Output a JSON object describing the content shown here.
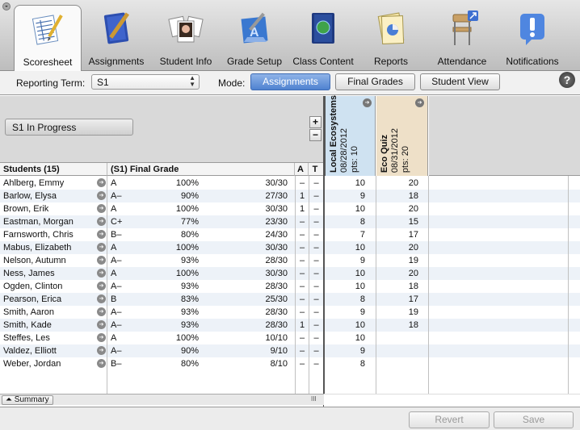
{
  "toolbar": {
    "items": [
      {
        "label": "Scoresheet",
        "icon": "scoresheet-icon",
        "active": true
      },
      {
        "label": "Assignments",
        "icon": "notebook-icon"
      },
      {
        "label": "Student Info",
        "icon": "photos-icon"
      },
      {
        "label": "Grade Setup",
        "icon": "blueprint-icon"
      },
      {
        "label": "Class Content",
        "icon": "globe-book-icon"
      },
      {
        "label": "Reports",
        "icon": "reports-icon"
      },
      {
        "label": "Attendance",
        "icon": "chair-icon"
      },
      {
        "label": "Notifications",
        "icon": "exclamation-icon"
      }
    ]
  },
  "filters": {
    "reporting_term_label": "Reporting Term:",
    "reporting_term_value": "S1",
    "mode_label": "Mode:",
    "modes": [
      "Assignments",
      "Final Grades",
      "Student View"
    ],
    "selected_mode": "Assignments",
    "help": "?"
  },
  "header": {
    "status_button": "S1 In Progress",
    "plus": "+",
    "minus": "−"
  },
  "assignments": [
    {
      "name": "Local Ecosystems",
      "date": "08/28/2012",
      "pts": "pts: 10",
      "color": "#cfe2f1"
    },
    {
      "name": "Eco Quiz",
      "date": "08/31/2012",
      "pts": "pts: 20",
      "color": "#eee0c8"
    }
  ],
  "table": {
    "columns": {
      "students": "Students (15)",
      "grade": "(S1) Final Grade",
      "a": "A",
      "t": "T"
    },
    "rows": [
      {
        "name": "Ahlberg, Emmy",
        "letter": "A",
        "pct": "100%",
        "frac": "30/30",
        "a": "–",
        "t": "–",
        "s1": "10",
        "s2": "20"
      },
      {
        "name": "Barlow, Elysa",
        "letter": "A–",
        "pct": "90%",
        "frac": "27/30",
        "a": "1",
        "t": "–",
        "s1": "9",
        "s2": "18"
      },
      {
        "name": "Brown, Erik",
        "letter": "A",
        "pct": "100%",
        "frac": "30/30",
        "a": "1",
        "t": "–",
        "s1": "10",
        "s2": "20"
      },
      {
        "name": "Eastman, Morgan",
        "letter": "C+",
        "pct": "77%",
        "frac": "23/30",
        "a": "–",
        "t": "–",
        "s1": "8",
        "s2": "15"
      },
      {
        "name": "Farnsworth, Chris",
        "letter": "B–",
        "pct": "80%",
        "frac": "24/30",
        "a": "–",
        "t": "–",
        "s1": "7",
        "s2": "17"
      },
      {
        "name": "Mabus, Elizabeth",
        "letter": "A",
        "pct": "100%",
        "frac": "30/30",
        "a": "–",
        "t": "–",
        "s1": "10",
        "s2": "20"
      },
      {
        "name": "Nelson, Autumn",
        "letter": "A–",
        "pct": "93%",
        "frac": "28/30",
        "a": "–",
        "t": "–",
        "s1": "9",
        "s2": "19"
      },
      {
        "name": "Ness, James",
        "letter": "A",
        "pct": "100%",
        "frac": "30/30",
        "a": "–",
        "t": "–",
        "s1": "10",
        "s2": "20"
      },
      {
        "name": "Ogden, Clinton",
        "letter": "A–",
        "pct": "93%",
        "frac": "28/30",
        "a": "–",
        "t": "–",
        "s1": "10",
        "s2": "18"
      },
      {
        "name": "Pearson, Erica",
        "letter": "B",
        "pct": "83%",
        "frac": "25/30",
        "a": "–",
        "t": "–",
        "s1": "8",
        "s2": "17"
      },
      {
        "name": "Smith, Aaron",
        "letter": "A–",
        "pct": "93%",
        "frac": "28/30",
        "a": "–",
        "t": "–",
        "s1": "9",
        "s2": "19"
      },
      {
        "name": "Smith, Kade",
        "letter": "A–",
        "pct": "93%",
        "frac": "28/30",
        "a": "1",
        "t": "–",
        "s1": "10",
        "s2": "18"
      },
      {
        "name": "Steffes, Les",
        "letter": "A",
        "pct": "100%",
        "frac": "10/10",
        "a": "–",
        "t": "–",
        "s1": "10",
        "s2": ""
      },
      {
        "name": "Valdez, Elliott",
        "letter": "A–",
        "pct": "90%",
        "frac": "9/10",
        "a": "–",
        "t": "–",
        "s1": "9",
        "s2": ""
      },
      {
        "name": "Weber, Jordan",
        "letter": "B–",
        "pct": "80%",
        "frac": "8/10",
        "a": "–",
        "t": "–",
        "s1": "8",
        "s2": ""
      }
    ]
  },
  "summary_button": "Summary",
  "column_resize": "III",
  "footer": {
    "revert": "Revert",
    "save": "Save"
  }
}
